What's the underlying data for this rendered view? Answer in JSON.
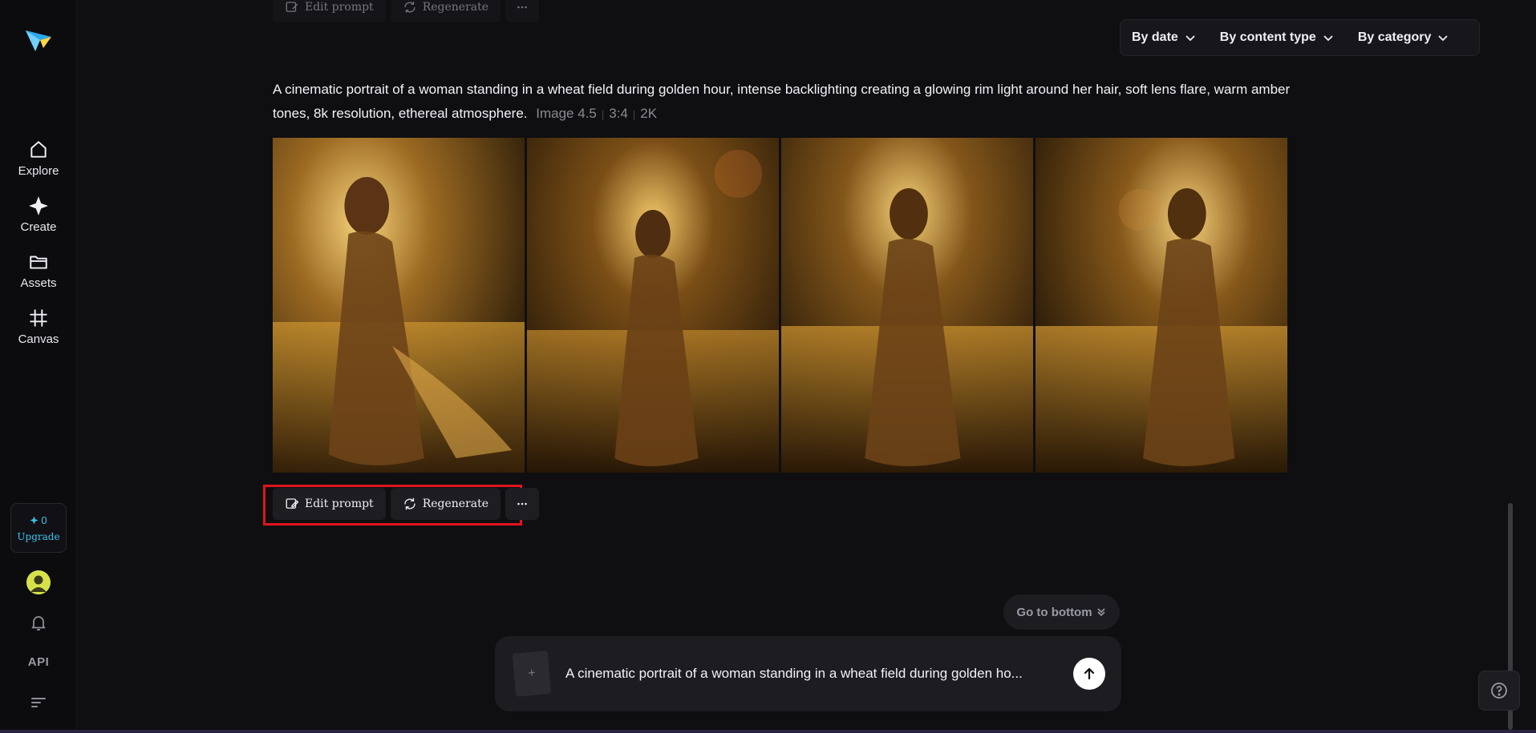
{
  "sidebar": {
    "nav": [
      {
        "label": "Explore",
        "icon": "home-icon"
      },
      {
        "label": "Create",
        "icon": "sparkle-icon"
      },
      {
        "label": "Assets",
        "icon": "folder-icon"
      },
      {
        "label": "Canvas",
        "icon": "frame-icon"
      }
    ],
    "credits": "0",
    "upgrade_label": "Upgrade",
    "api_label": "API"
  },
  "filters": {
    "by_date": "By date",
    "by_content_type": "By content type",
    "by_category": "By category"
  },
  "generation": {
    "prompt": "A cinematic portrait of a woman standing in a wheat field during golden hour, intense backlighting creating a glowing rim light around her hair, soft lens flare, warm amber tones, 8k resolution, ethereal atmosphere.",
    "model": "Image 4.5",
    "aspect_ratio": "3:4",
    "resolution": "2K",
    "image_count": 4
  },
  "actions": {
    "edit_prompt": "Edit prompt",
    "regenerate": "Regenerate",
    "more": "more-icon"
  },
  "go_bottom_label": "Go to bottom",
  "composer": {
    "value": "A cinematic portrait of a woman standing in a wheat field during golden ho..."
  },
  "colors": {
    "accent": "#39c3ef",
    "highlight_outline": "#e0141c",
    "background": "#0f0f12"
  }
}
